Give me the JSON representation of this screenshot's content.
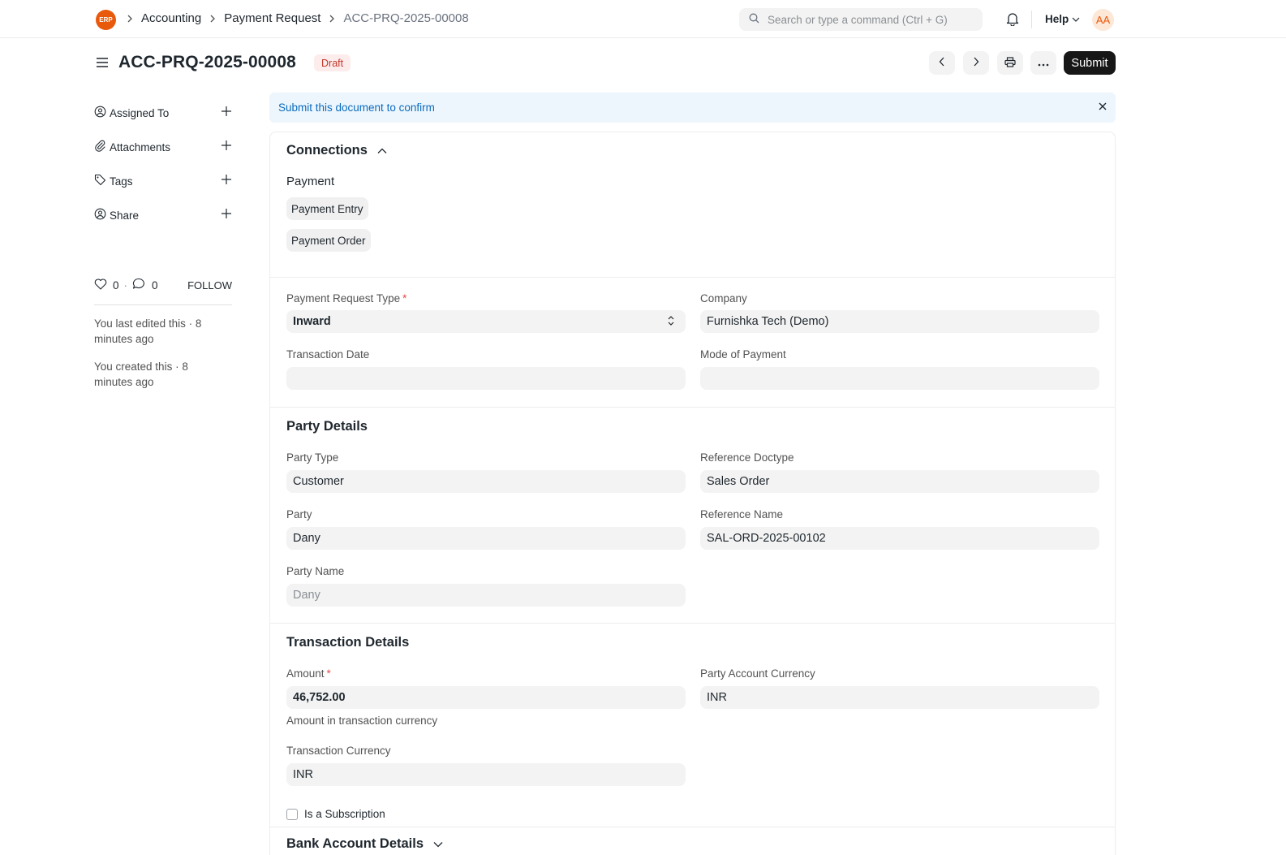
{
  "navbar": {
    "logo_text": "ERP",
    "breadcrumbs": [
      "Accounting",
      "Payment Request",
      "ACC-PRQ-2025-00008"
    ],
    "search_placeholder": "Search or type a command (Ctrl + G)",
    "help_label": "Help",
    "avatar_initials": "AA"
  },
  "page": {
    "title": "ACC-PRQ-2025-00008",
    "status_badge": "Draft",
    "submit_label": "Submit"
  },
  "sidebar": {
    "items": [
      {
        "label": "Assigned To",
        "icon": "assign-icon"
      },
      {
        "label": "Attachments",
        "icon": "paperclip-icon"
      },
      {
        "label": "Tags",
        "icon": "tag-icon"
      },
      {
        "label": "Share",
        "icon": "share-icon"
      }
    ],
    "likes": "0",
    "comments": "0",
    "follow_label": "FOLLOW",
    "activity": [
      "You last edited this · 8 minutes ago",
      "You created this · 8 minutes ago"
    ]
  },
  "alert": {
    "message": "Submit this document to confirm"
  },
  "connections": {
    "title": "Connections",
    "group_label": "Payment",
    "links": [
      "Payment Entry",
      "Payment Order"
    ]
  },
  "main_section": {
    "payment_request_type_label": "Payment Request Type",
    "payment_request_type_value": "Inward",
    "company_label": "Company",
    "company_value": "Furnishka Tech (Demo)",
    "transaction_date_label": "Transaction Date",
    "transaction_date_value": "",
    "mode_of_payment_label": "Mode of Payment",
    "mode_of_payment_value": ""
  },
  "party_details": {
    "title": "Party Details",
    "party_type_label": "Party Type",
    "party_type_value": "Customer",
    "reference_doctype_label": "Reference Doctype",
    "reference_doctype_value": "Sales Order",
    "party_label": "Party",
    "party_value": "Dany",
    "reference_name_label": "Reference Name",
    "reference_name_value": "SAL-ORD-2025-00102",
    "party_name_label": "Party Name",
    "party_name_value": "Dany"
  },
  "transaction_details": {
    "title": "Transaction Details",
    "amount_label": "Amount",
    "amount_value": "46,752.00",
    "amount_help": "Amount in transaction currency",
    "party_account_currency_label": "Party Account Currency",
    "party_account_currency_value": "INR",
    "transaction_currency_label": "Transaction Currency",
    "transaction_currency_value": "INR",
    "is_subscription_label": "Is a Subscription"
  },
  "bank_account_details": {
    "title": "Bank Account Details"
  },
  "colors": {
    "primary_button": "#171717",
    "brand": "#e8590c",
    "alert_bg": "#edf6fd",
    "alert_text": "#0b6bbd",
    "draft_badge_bg": "#fdecec",
    "draft_badge_text": "#c0392b"
  }
}
